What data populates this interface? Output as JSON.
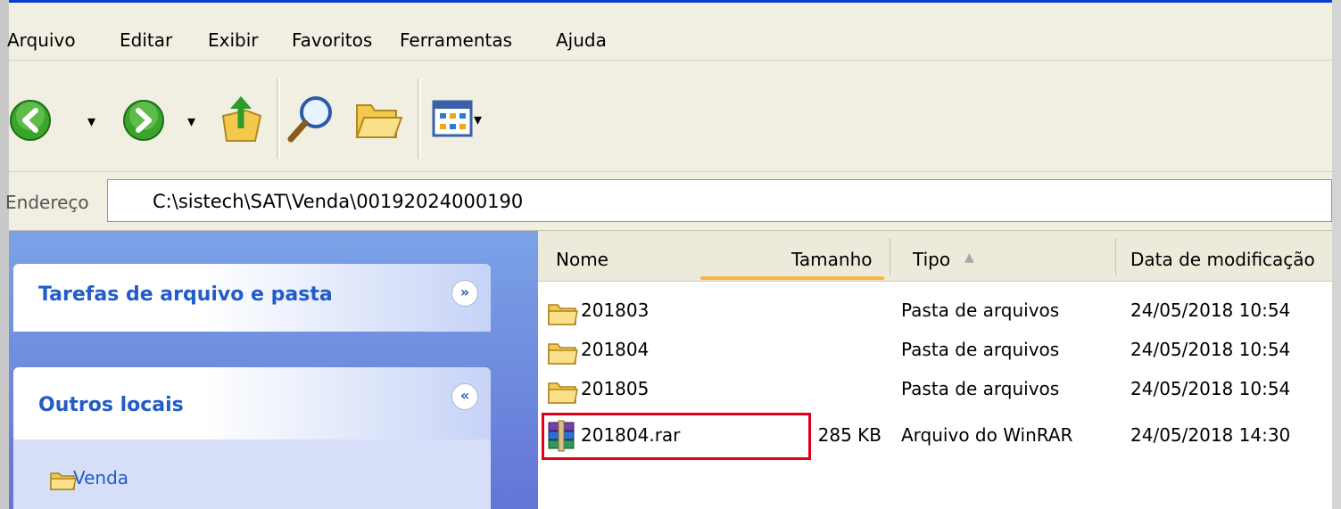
{
  "menu": {
    "items": [
      "Arquivo",
      "Editar",
      "Exibir",
      "Favoritos",
      "Ferramentas",
      "Ajuda"
    ]
  },
  "toolbar": {
    "buttons": [
      "back-icon",
      "forward-icon",
      "up-folder-icon",
      "search-icon",
      "folders-icon",
      "views-icon"
    ],
    "dropdown_glyph": "▾"
  },
  "address": {
    "label": "Endereço",
    "value": "C:\\sistech\\SAT\\Venda\\00192024000190"
  },
  "taskpane": {
    "panel1_title": "Tarefas de arquivo e pasta",
    "panel1_toggle": "»",
    "panel2_title": "Outros locais",
    "panel2_toggle": "«",
    "links": [
      "Venda"
    ]
  },
  "filelist": {
    "columns": {
      "name": "Nome",
      "size": "Tamanho",
      "type": "Tipo",
      "sort_glyph": "▲",
      "date": "Data de modificação"
    },
    "rows": [
      {
        "name": "201803",
        "size": "",
        "type": "Pasta de arquivos",
        "date": "24/05/2018 10:54",
        "icon": "folder-icon"
      },
      {
        "name": "201804",
        "size": "",
        "type": "Pasta de arquivos",
        "date": "24/05/2018 10:54",
        "icon": "folder-icon"
      },
      {
        "name": "201805",
        "size": "",
        "type": "Pasta de arquivos",
        "date": "24/05/2018 10:54",
        "icon": "folder-icon"
      },
      {
        "name": "201804.rar",
        "size": "285 KB",
        "type": "Arquivo do WinRAR",
        "date": "24/05/2018 14:30",
        "icon": "winrar-archive-icon"
      }
    ]
  },
  "colors": {
    "highlight": "#e1001a",
    "link": "#215dc6",
    "pane": "#6f8ddc"
  }
}
